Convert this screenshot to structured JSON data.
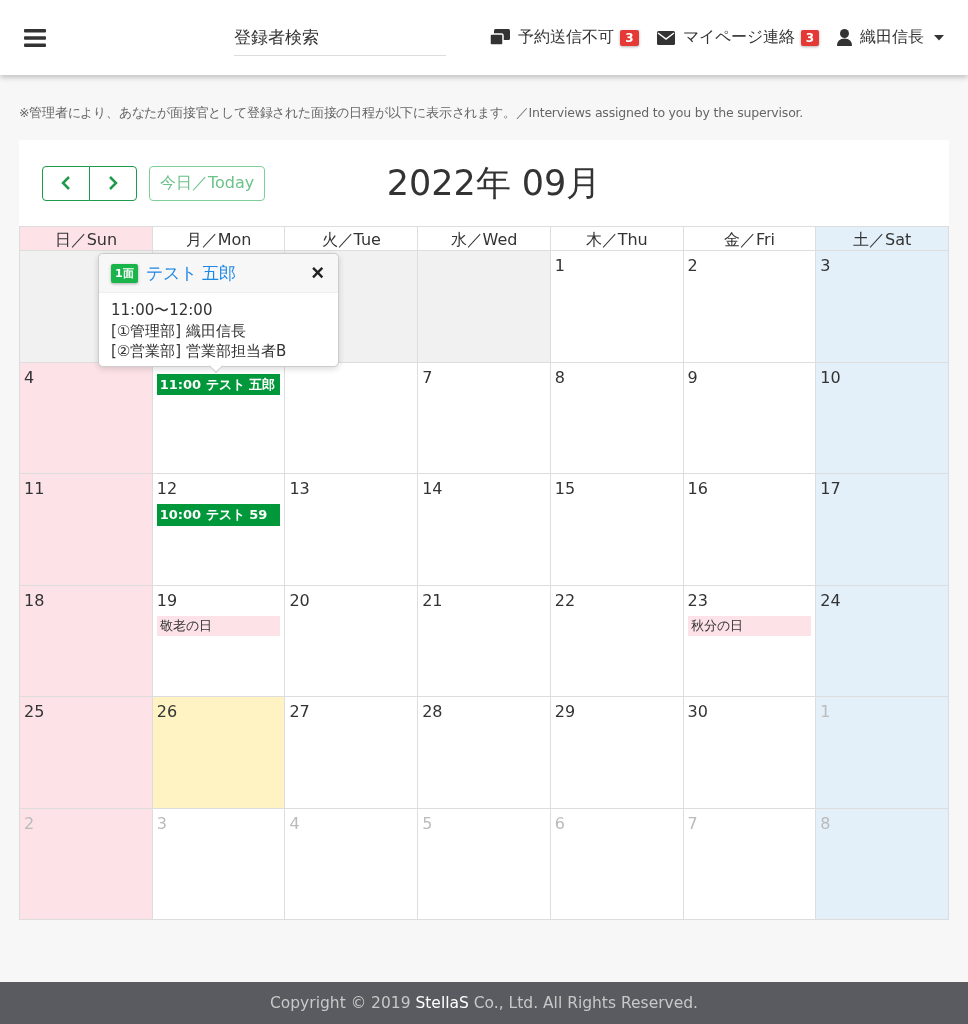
{
  "header": {
    "search": {
      "placeholder": "登録者検索"
    },
    "nav": [
      {
        "kind": "reservation",
        "label": "予約送信不可",
        "badge": "3"
      },
      {
        "kind": "mail",
        "label": "マイページ連絡",
        "badge": "3"
      },
      {
        "kind": "user",
        "label": "織田信長"
      }
    ]
  },
  "notice": "※管理者により、あなたが面接官として登録された面接の日程が以下に表示されます。／Interviews assigned to you by the supervisor.",
  "calendar": {
    "today_button": "今日／Today",
    "title": "2022年 09月",
    "weekdays": [
      "日／Sun",
      "月／Mon",
      "火／Tue",
      "水／Wed",
      "木／Thu",
      "金／Fri",
      "土／Sat"
    ],
    "weeks": [
      [
        {
          "kind": "blank"
        },
        {
          "kind": "blank"
        },
        {
          "kind": "blank"
        },
        {
          "kind": "blank"
        },
        {
          "kind": "current",
          "day": "1"
        },
        {
          "kind": "current",
          "day": "2"
        },
        {
          "kind": "current",
          "day": "3"
        }
      ],
      [
        {
          "kind": "current",
          "day": "4"
        },
        {
          "kind": "current",
          "events": [
            {
              "kind": "interview",
              "text": "11:00 テスト 五郎"
            }
          ]
        },
        {
          "kind": "current"
        },
        {
          "kind": "current",
          "day": "7"
        },
        {
          "kind": "current",
          "day": "8"
        },
        {
          "kind": "current",
          "day": "9"
        },
        {
          "kind": "current",
          "day": "10"
        }
      ],
      [
        {
          "kind": "current",
          "day": "11"
        },
        {
          "kind": "current",
          "day": "12",
          "events": [
            {
              "kind": "interview",
              "text": "10:00 テスト 59"
            }
          ]
        },
        {
          "kind": "current",
          "day": "13"
        },
        {
          "kind": "current",
          "day": "14"
        },
        {
          "kind": "current",
          "day": "15"
        },
        {
          "kind": "current",
          "day": "16"
        },
        {
          "kind": "current",
          "day": "17"
        }
      ],
      [
        {
          "kind": "current",
          "day": "18"
        },
        {
          "kind": "current",
          "day": "19",
          "events": [
            {
              "kind": "holiday",
              "text": "敬老の日"
            }
          ]
        },
        {
          "kind": "current",
          "day": "20"
        },
        {
          "kind": "current",
          "day": "21"
        },
        {
          "kind": "current",
          "day": "22"
        },
        {
          "kind": "current",
          "day": "23",
          "events": [
            {
              "kind": "holiday",
              "text": "秋分の日"
            }
          ]
        },
        {
          "kind": "current",
          "day": "24"
        }
      ],
      [
        {
          "kind": "current",
          "day": "25"
        },
        {
          "kind": "current",
          "day": "26",
          "today": true
        },
        {
          "kind": "current",
          "day": "27"
        },
        {
          "kind": "current",
          "day": "28"
        },
        {
          "kind": "current",
          "day": "29"
        },
        {
          "kind": "current",
          "day": "30"
        },
        {
          "kind": "other",
          "day": "1"
        }
      ],
      [
        {
          "kind": "other",
          "day": "2"
        },
        {
          "kind": "other",
          "day": "3"
        },
        {
          "kind": "other",
          "day": "4"
        },
        {
          "kind": "other",
          "day": "5"
        },
        {
          "kind": "other",
          "day": "6"
        },
        {
          "kind": "other",
          "day": "7"
        },
        {
          "kind": "other",
          "day": "8"
        }
      ]
    ],
    "popover": {
      "badge": "1面",
      "title": "テスト 五郎",
      "close": "×",
      "lines": [
        "11:00〜12:00",
        "[①管理部] 織田信長",
        "[②営業部] 営業部担当者B"
      ]
    }
  },
  "footer": {
    "before": "Copyright © 2019 ",
    "brand": "StellaS",
    "after": " Co., Ltd. All Rights Reserved."
  }
}
